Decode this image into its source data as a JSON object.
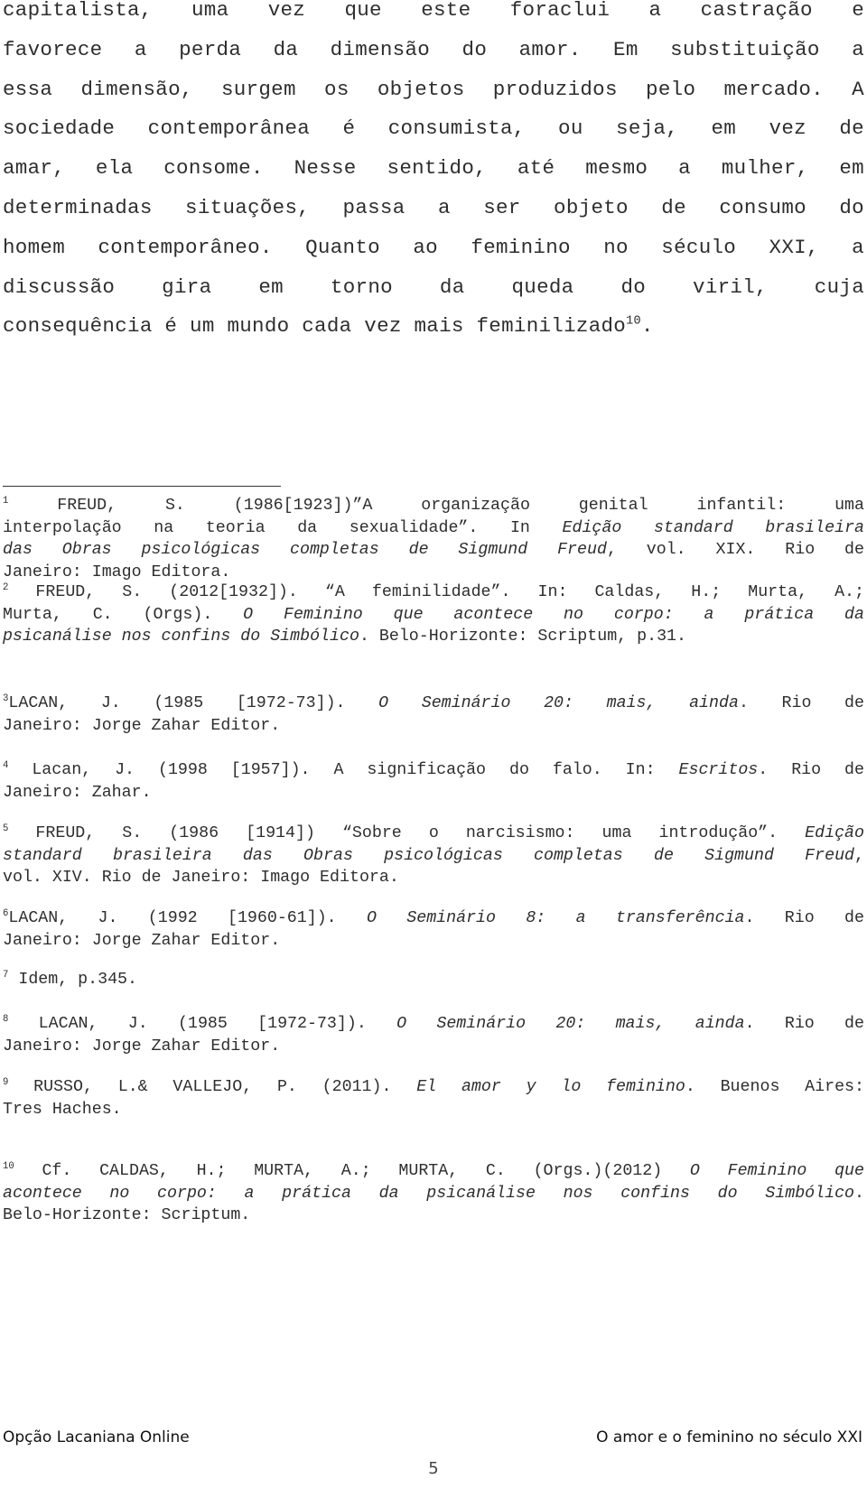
{
  "body": {
    "lines": [
      "capitalista, uma vez que este foraclui a castração e",
      "favorece a perda da dimensão do amor. Em substituição a",
      "essa dimensão, surgem os objetos produzidos pelo mercado. A",
      "sociedade contemporânea é consumista, ou seja, em vez de",
      "amar, ela consome. Nesse sentido, até mesmo a mulher, em",
      "determinadas situações, passa a ser objeto de consumo do",
      "homem contemporâneo. Quanto ao feminino no século XXI, a",
      "discussão gira em torno da queda do viril, cuja",
      "consequência é um mundo cada vez mais feminilizado"
    ],
    "last_line_ref": "10",
    "last_line_end": "."
  },
  "footnotes": [
    {
      "num": "1",
      "lines": [
        [
          {
            "t": " FREUD, S. (1986[1923])”A organização genital infantil: uma"
          }
        ],
        [
          {
            "t": "interpolação na teoria da sexualidade”. In "
          },
          {
            "t": "Edição standard brasileira",
            "i": true
          }
        ],
        [
          {
            "t": "das Obras psicológicas completas de Sigmund Freud",
            "i": true
          },
          {
            "t": ", vol. XIX. Rio de"
          }
        ],
        [
          {
            "t": "Janeiro: Imago Editora."
          }
        ]
      ]
    },
    {
      "num": "2",
      "lines": [
        [
          {
            "t": " FREUD, S. (2012[1932]). “A feminilidade”. In: Caldas, H.; Murta, A.;"
          }
        ],
        [
          {
            "t": "Murta, C. (Orgs). "
          },
          {
            "t": "O Feminino que acontece no corpo: a prática da",
            "i": true
          }
        ],
        [
          {
            "t": "psicanálise nos confins do Simbólico",
            "i": true
          },
          {
            "t": ". Belo-Horizonte: Scriptum, p.31."
          }
        ]
      ]
    },
    {
      "num": "3",
      "lines": [
        [
          {
            "t": "LACAN, J. (1985 [1972-73]). "
          },
          {
            "t": "O Seminário 20: mais, ainda",
            "i": true
          },
          {
            "t": ". Rio de"
          }
        ],
        [
          {
            "t": "Janeiro: Jorge Zahar Editor."
          }
        ]
      ]
    },
    {
      "num": "4",
      "lines": [
        [
          {
            "t": " Lacan, J. (1998 [1957]). A significação do falo. In: "
          },
          {
            "t": "Escritos",
            "i": true
          },
          {
            "t": ". Rio de"
          }
        ],
        [
          {
            "t": "Janeiro: Zahar."
          }
        ]
      ]
    },
    {
      "num": "5",
      "lines": [
        [
          {
            "t": " FREUD, S. (1986 [1914]) “Sobre o narcisismo: uma introdução”. "
          },
          {
            "t": "Edição",
            "i": true
          }
        ],
        [
          {
            "t": "standard brasileira das Obras psicológicas completas de Sigmund Freud",
            "i": true
          },
          {
            "t": ","
          }
        ],
        [
          {
            "t": "vol. XIV. Rio de Janeiro: Imago Editora."
          }
        ]
      ]
    },
    {
      "num": "6",
      "lines": [
        [
          {
            "t": "LACAN, J. (1992 [1960-61]). "
          },
          {
            "t": "O Seminário 8: a transferência",
            "i": true
          },
          {
            "t": ". Rio de"
          }
        ],
        [
          {
            "t": "Janeiro: Jorge Zahar Editor."
          }
        ]
      ]
    },
    {
      "num": "7",
      "lines": [
        [
          {
            "t": " Idem, p.345."
          }
        ]
      ]
    },
    {
      "num": "8",
      "lines": [
        [
          {
            "t": " LACAN, J. (1985 [1972-73]). "
          },
          {
            "t": "O Seminário 20: mais, ainda",
            "i": true
          },
          {
            "t": ". Rio de"
          }
        ],
        [
          {
            "t": "Janeiro: Jorge Zahar Editor."
          }
        ]
      ]
    },
    {
      "num": "9",
      "lines": [
        [
          {
            "t": " RUSSO, L.& VALLEJO, P. (2011). "
          },
          {
            "t": "El amor y lo feminino",
            "i": true
          },
          {
            "t": ". Buenos Aires:"
          }
        ],
        [
          {
            "t": "Tres Haches."
          }
        ]
      ]
    },
    {
      "num": "10",
      "lines": [
        [
          {
            "t": " Cf. CALDAS, H.; MURTA, A.; MURTA, C. (Orgs.)(2012) "
          },
          {
            "t": "O Feminino que",
            "i": true
          }
        ],
        [
          {
            "t": "acontece no corpo: a prática da psicanálise nos confins do Simbólico",
            "i": true
          },
          {
            "t": "."
          }
        ],
        [
          {
            "t": "Belo-Horizonte: Scriptum."
          }
        ]
      ]
    }
  ],
  "footer": {
    "left": "Opção Lacaniana Online",
    "right": "O amor e o feminino no século XXI",
    "page_number": "5"
  }
}
